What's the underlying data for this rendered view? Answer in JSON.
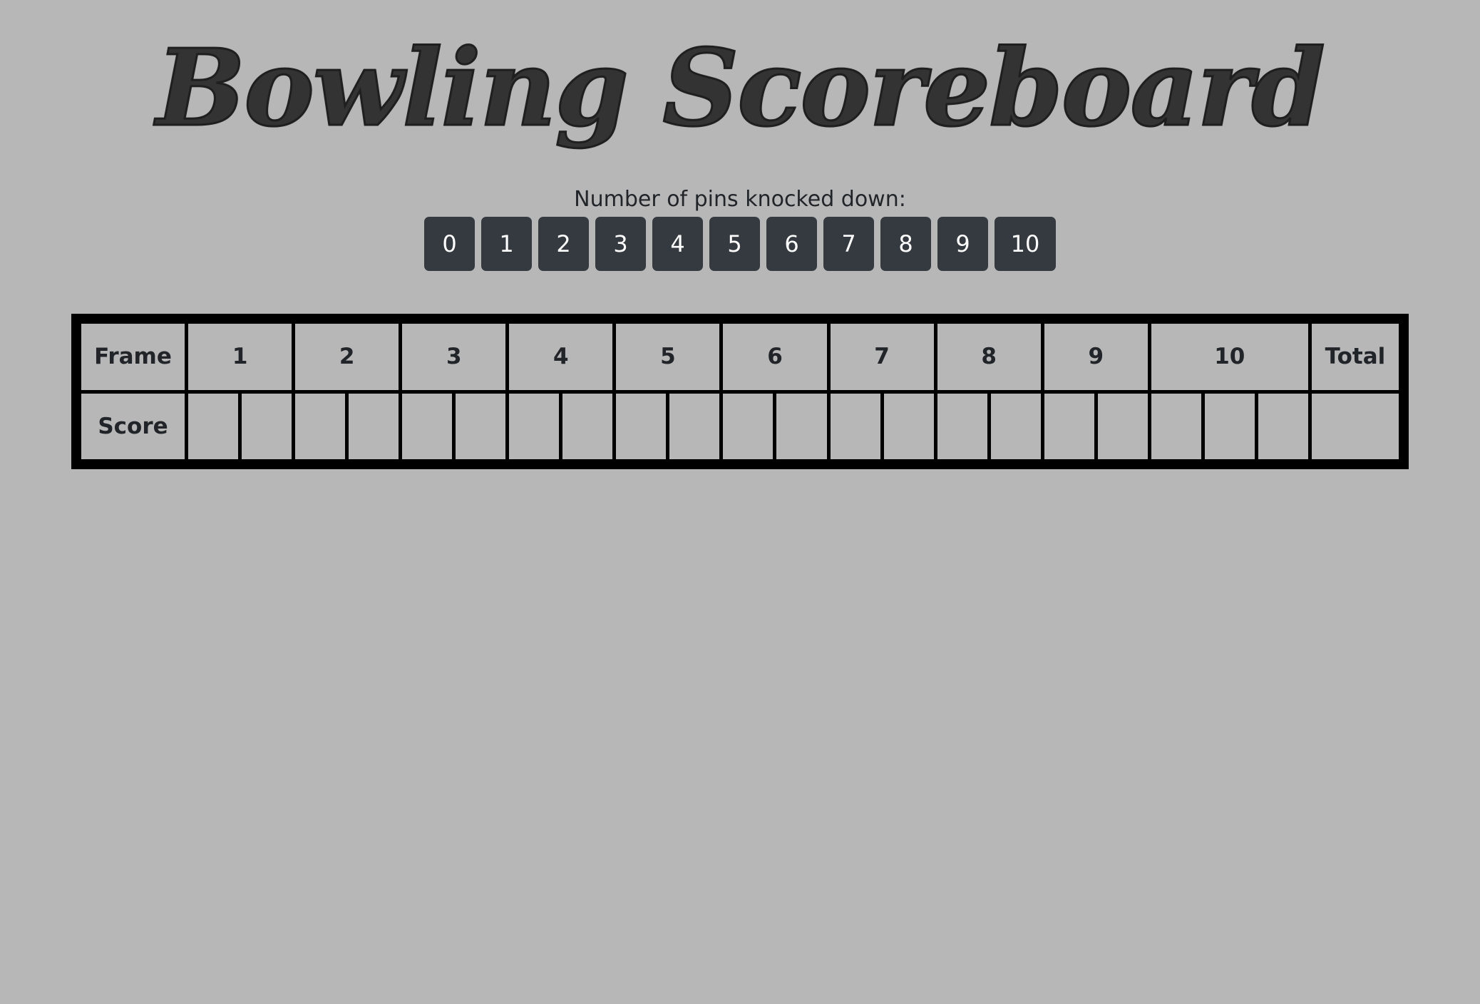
{
  "header": {
    "title": "Bowling Scoreboard"
  },
  "pins": {
    "label": "Number of pins knocked down:",
    "buttons": [
      "0",
      "1",
      "2",
      "3",
      "4",
      "5",
      "6",
      "7",
      "8",
      "9",
      "10"
    ]
  },
  "scoreboard": {
    "frame_label": "Frame",
    "score_label": "Score",
    "total_label": "Total",
    "frames": [
      "1",
      "2",
      "3",
      "4",
      "5",
      "6",
      "7",
      "8",
      "9",
      "10"
    ],
    "scores": [
      [
        "",
        ""
      ],
      [
        "",
        ""
      ],
      [
        "",
        ""
      ],
      [
        "",
        ""
      ],
      [
        "",
        ""
      ],
      [
        "",
        ""
      ],
      [
        "",
        ""
      ],
      [
        "",
        ""
      ],
      [
        "",
        ""
      ],
      [
        "",
        "",
        ""
      ]
    ],
    "total": ""
  },
  "colors": {
    "background": "#b7b7b7",
    "button": "#343a40",
    "button_text": "#ffffff",
    "border": "#000000"
  }
}
